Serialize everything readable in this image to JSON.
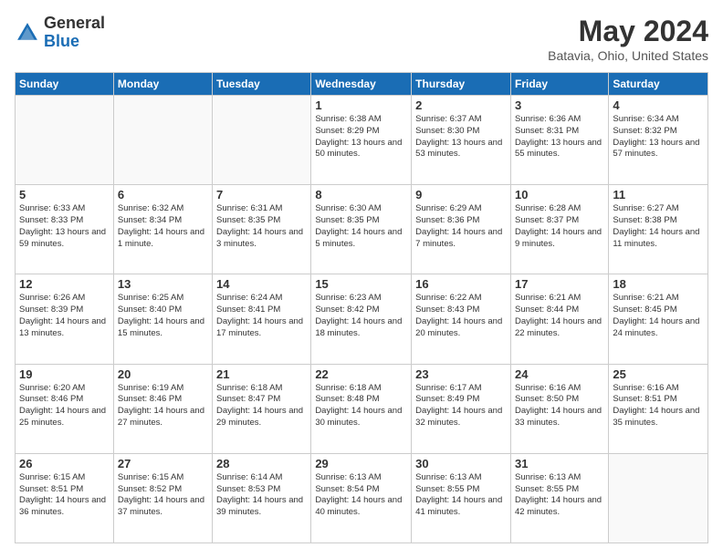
{
  "header": {
    "logo_general": "General",
    "logo_blue": "Blue",
    "month_title": "May 2024",
    "location": "Batavia, Ohio, United States"
  },
  "days_of_week": [
    "Sunday",
    "Monday",
    "Tuesday",
    "Wednesday",
    "Thursday",
    "Friday",
    "Saturday"
  ],
  "weeks": [
    [
      {
        "day": "",
        "sunrise": "",
        "sunset": "",
        "daylight": "",
        "empty": true
      },
      {
        "day": "",
        "sunrise": "",
        "sunset": "",
        "daylight": "",
        "empty": true
      },
      {
        "day": "",
        "sunrise": "",
        "sunset": "",
        "daylight": "",
        "empty": true
      },
      {
        "day": "1",
        "sunrise": "Sunrise: 6:38 AM",
        "sunset": "Sunset: 8:29 PM",
        "daylight": "Daylight: 13 hours and 50 minutes."
      },
      {
        "day": "2",
        "sunrise": "Sunrise: 6:37 AM",
        "sunset": "Sunset: 8:30 PM",
        "daylight": "Daylight: 13 hours and 53 minutes."
      },
      {
        "day": "3",
        "sunrise": "Sunrise: 6:36 AM",
        "sunset": "Sunset: 8:31 PM",
        "daylight": "Daylight: 13 hours and 55 minutes."
      },
      {
        "day": "4",
        "sunrise": "Sunrise: 6:34 AM",
        "sunset": "Sunset: 8:32 PM",
        "daylight": "Daylight: 13 hours and 57 minutes."
      }
    ],
    [
      {
        "day": "5",
        "sunrise": "Sunrise: 6:33 AM",
        "sunset": "Sunset: 8:33 PM",
        "daylight": "Daylight: 13 hours and 59 minutes."
      },
      {
        "day": "6",
        "sunrise": "Sunrise: 6:32 AM",
        "sunset": "Sunset: 8:34 PM",
        "daylight": "Daylight: 14 hours and 1 minute."
      },
      {
        "day": "7",
        "sunrise": "Sunrise: 6:31 AM",
        "sunset": "Sunset: 8:35 PM",
        "daylight": "Daylight: 14 hours and 3 minutes."
      },
      {
        "day": "8",
        "sunrise": "Sunrise: 6:30 AM",
        "sunset": "Sunset: 8:35 PM",
        "daylight": "Daylight: 14 hours and 5 minutes."
      },
      {
        "day": "9",
        "sunrise": "Sunrise: 6:29 AM",
        "sunset": "Sunset: 8:36 PM",
        "daylight": "Daylight: 14 hours and 7 minutes."
      },
      {
        "day": "10",
        "sunrise": "Sunrise: 6:28 AM",
        "sunset": "Sunset: 8:37 PM",
        "daylight": "Daylight: 14 hours and 9 minutes."
      },
      {
        "day": "11",
        "sunrise": "Sunrise: 6:27 AM",
        "sunset": "Sunset: 8:38 PM",
        "daylight": "Daylight: 14 hours and 11 minutes."
      }
    ],
    [
      {
        "day": "12",
        "sunrise": "Sunrise: 6:26 AM",
        "sunset": "Sunset: 8:39 PM",
        "daylight": "Daylight: 14 hours and 13 minutes."
      },
      {
        "day": "13",
        "sunrise": "Sunrise: 6:25 AM",
        "sunset": "Sunset: 8:40 PM",
        "daylight": "Daylight: 14 hours and 15 minutes."
      },
      {
        "day": "14",
        "sunrise": "Sunrise: 6:24 AM",
        "sunset": "Sunset: 8:41 PM",
        "daylight": "Daylight: 14 hours and 17 minutes."
      },
      {
        "day": "15",
        "sunrise": "Sunrise: 6:23 AM",
        "sunset": "Sunset: 8:42 PM",
        "daylight": "Daylight: 14 hours and 18 minutes."
      },
      {
        "day": "16",
        "sunrise": "Sunrise: 6:22 AM",
        "sunset": "Sunset: 8:43 PM",
        "daylight": "Daylight: 14 hours and 20 minutes."
      },
      {
        "day": "17",
        "sunrise": "Sunrise: 6:21 AM",
        "sunset": "Sunset: 8:44 PM",
        "daylight": "Daylight: 14 hours and 22 minutes."
      },
      {
        "day": "18",
        "sunrise": "Sunrise: 6:21 AM",
        "sunset": "Sunset: 8:45 PM",
        "daylight": "Daylight: 14 hours and 24 minutes."
      }
    ],
    [
      {
        "day": "19",
        "sunrise": "Sunrise: 6:20 AM",
        "sunset": "Sunset: 8:46 PM",
        "daylight": "Daylight: 14 hours and 25 minutes."
      },
      {
        "day": "20",
        "sunrise": "Sunrise: 6:19 AM",
        "sunset": "Sunset: 8:46 PM",
        "daylight": "Daylight: 14 hours and 27 minutes."
      },
      {
        "day": "21",
        "sunrise": "Sunrise: 6:18 AM",
        "sunset": "Sunset: 8:47 PM",
        "daylight": "Daylight: 14 hours and 29 minutes."
      },
      {
        "day": "22",
        "sunrise": "Sunrise: 6:18 AM",
        "sunset": "Sunset: 8:48 PM",
        "daylight": "Daylight: 14 hours and 30 minutes."
      },
      {
        "day": "23",
        "sunrise": "Sunrise: 6:17 AM",
        "sunset": "Sunset: 8:49 PM",
        "daylight": "Daylight: 14 hours and 32 minutes."
      },
      {
        "day": "24",
        "sunrise": "Sunrise: 6:16 AM",
        "sunset": "Sunset: 8:50 PM",
        "daylight": "Daylight: 14 hours and 33 minutes."
      },
      {
        "day": "25",
        "sunrise": "Sunrise: 6:16 AM",
        "sunset": "Sunset: 8:51 PM",
        "daylight": "Daylight: 14 hours and 35 minutes."
      }
    ],
    [
      {
        "day": "26",
        "sunrise": "Sunrise: 6:15 AM",
        "sunset": "Sunset: 8:51 PM",
        "daylight": "Daylight: 14 hours and 36 minutes."
      },
      {
        "day": "27",
        "sunrise": "Sunrise: 6:15 AM",
        "sunset": "Sunset: 8:52 PM",
        "daylight": "Daylight: 14 hours and 37 minutes."
      },
      {
        "day": "28",
        "sunrise": "Sunrise: 6:14 AM",
        "sunset": "Sunset: 8:53 PM",
        "daylight": "Daylight: 14 hours and 39 minutes."
      },
      {
        "day": "29",
        "sunrise": "Sunrise: 6:13 AM",
        "sunset": "Sunset: 8:54 PM",
        "daylight": "Daylight: 14 hours and 40 minutes."
      },
      {
        "day": "30",
        "sunrise": "Sunrise: 6:13 AM",
        "sunset": "Sunset: 8:55 PM",
        "daylight": "Daylight: 14 hours and 41 minutes."
      },
      {
        "day": "31",
        "sunrise": "Sunrise: 6:13 AM",
        "sunset": "Sunset: 8:55 PM",
        "daylight": "Daylight: 14 hours and 42 minutes."
      },
      {
        "day": "",
        "sunrise": "",
        "sunset": "",
        "daylight": "",
        "empty": true
      }
    ]
  ]
}
